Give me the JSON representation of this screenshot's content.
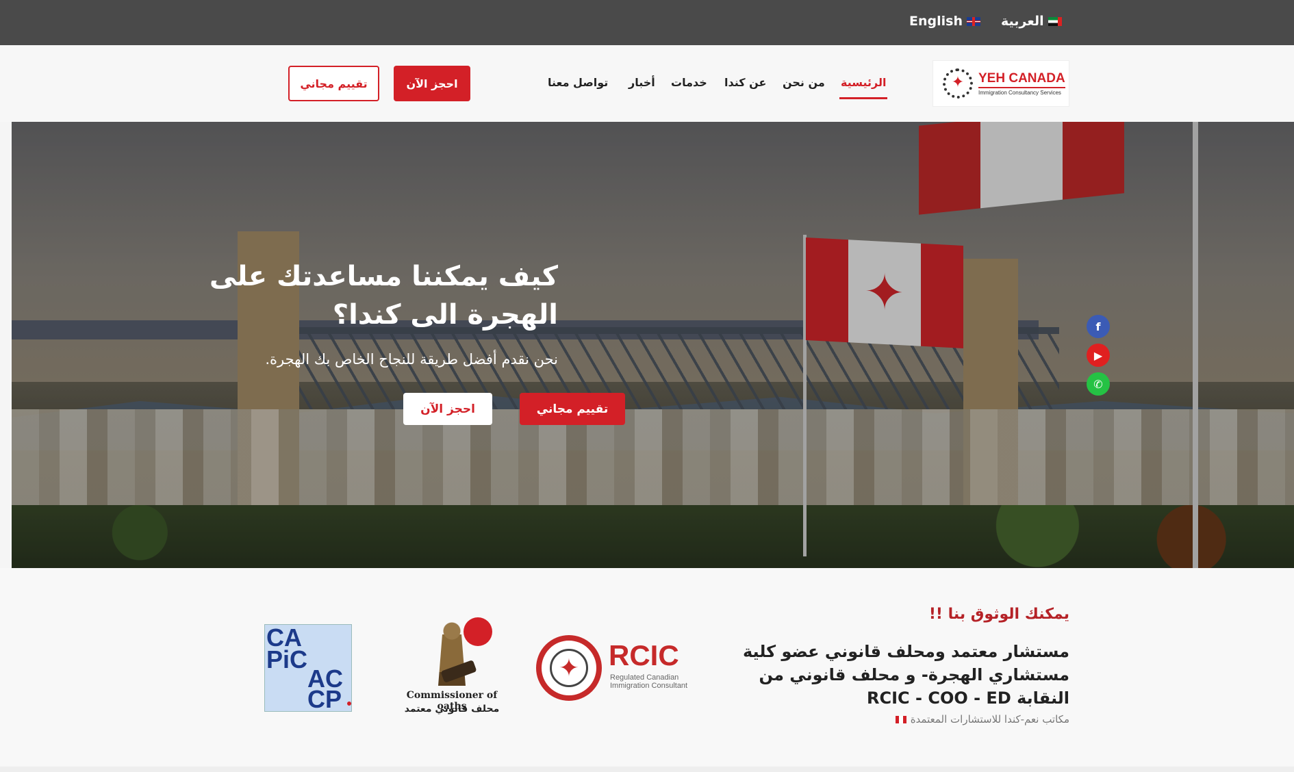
{
  "topbar": {
    "lang_english": "English",
    "lang_arabic": "العربية"
  },
  "logo": {
    "title": "YEH CANADA",
    "subtitle": "Immigration Consultancy Services"
  },
  "nav": {
    "home": "الرئيسية",
    "about_us": "من نحن",
    "about_canada": "عن كندا",
    "services": "خدمات",
    "news": "أخبار",
    "contact": "تواصل معنا",
    "book_now": "احجز الآن",
    "free_assessment": "تقييم مجاني"
  },
  "hero": {
    "title": "كيف يمكننا مساعدتك على الهجرة الى كندا؟",
    "subtitle": "نحن نقدم أفضل طريقة للنجاح الخاص بك الهجرة.",
    "free_assessment": "تقييم مجاني",
    "book_now": "احجز الآن"
  },
  "social": {
    "facebook_icon": "facebook-icon",
    "youtube_icon": "youtube-icon",
    "whatsapp_icon": "whatsapp-icon"
  },
  "trust": {
    "title": "يمكنك الوثوق بنا !!",
    "body": "مستشار معتمد ومحلف قانوني عضو كلية مستشاري الهجرة- و محلف قانوني من النقابة RCIC - COO - ED",
    "small": "مكاتب نعم-كندا للاستشارات المعتمدة"
  },
  "badges": {
    "rcic_big": "RCIC",
    "rcic_small": "Regulated Canadian Immigration Consultant",
    "oath_en": "Commissioner of oaths",
    "oath_ar": "محلف قانوني معتمد",
    "capic_1": "CA",
    "capic_2": "PiC",
    "capic_3": "AC",
    "capic_4": "CP"
  },
  "colors": {
    "brand_red": "#d32027",
    "topbar": "#4a4a4a"
  }
}
